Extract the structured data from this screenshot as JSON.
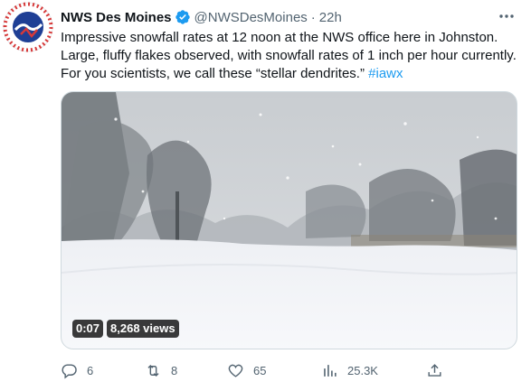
{
  "tweet": {
    "author": {
      "name": "NWS Des Moines",
      "handle": "@NWSDesMoines",
      "separator": "·",
      "time": "22h",
      "avatar_icon": "nws-logo-icon",
      "verified_icon": "verified-badge-icon",
      "logo_text": "NATIONAL WEATHER SERVICE"
    },
    "text": {
      "body": "Impressive snowfall rates at 12 noon at the NWS office here in Johnston. Large, fluffy flakes observed, with snowfall rates of 1 inch per hour currently. For you scientists, we call these “stellar dendrites.” ",
      "hashtag": "#iawx"
    },
    "media": {
      "duration": "0:07",
      "views": "8,268 views"
    },
    "actions": {
      "replies": "6",
      "retweets": "8",
      "likes": "65",
      "views": "25.3K"
    }
  },
  "colors": {
    "text_primary": "#0f1419",
    "text_secondary": "#536471",
    "link": "#1d9bf0",
    "verified": "#1d9bf0"
  }
}
